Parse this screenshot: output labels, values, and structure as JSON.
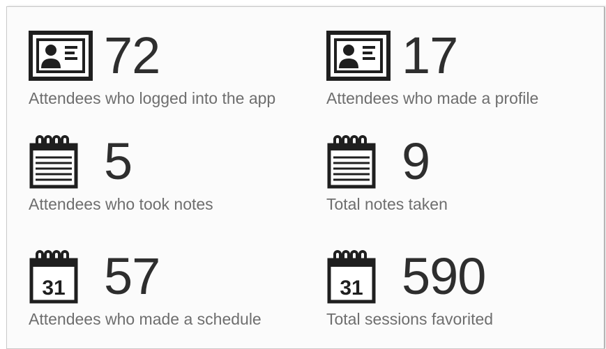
{
  "stats": [
    {
      "icon": "contact-card-icon",
      "value": "72",
      "label": "Attendees who logged into the app"
    },
    {
      "icon": "contact-card-icon",
      "value": "17",
      "label": "Attendees who made a profile"
    },
    {
      "icon": "notepad-icon",
      "value": "5",
      "label": "Attendees who took notes"
    },
    {
      "icon": "notepad-icon",
      "value": "9",
      "label": "Total notes taken"
    },
    {
      "icon": "calendar-icon",
      "value": "57",
      "label": "Attendees who made a schedule"
    },
    {
      "icon": "calendar-icon",
      "value": "590",
      "label": "Total sessions favorited"
    }
  ],
  "calendar_day": "31",
  "colors": {
    "icon": "#1f1f1f",
    "value": "#2e2e2e",
    "label": "#6e6e6e"
  }
}
